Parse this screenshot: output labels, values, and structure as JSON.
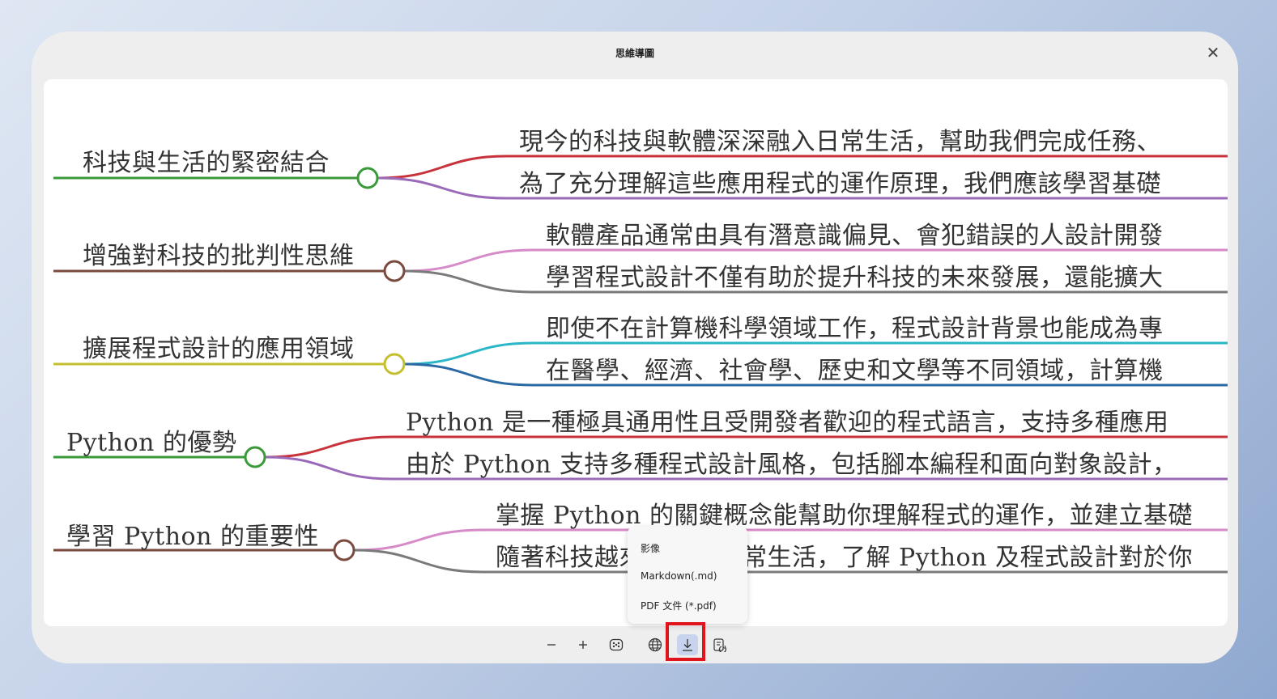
{
  "window": {
    "title": "思維導圖"
  },
  "mindmap": {
    "branches": [
      {
        "topic": "科技與生活的緊密結合",
        "node_color": "#3a9a3a",
        "children": [
          {
            "text": "現今的科技與軟體深深融入日常生活，幫助我們完成任務、",
            "color": "#c8323a"
          },
          {
            "text": "為了充分理解這些應用程式的運作原理，我們應該學習基礎",
            "color": "#9a6ab8"
          }
        ]
      },
      {
        "topic": "增強對科技的批判性思維",
        "node_color": "#7a4a3e",
        "children": [
          {
            "text": "軟體產品通常由具有潛意識偏見、會犯錯誤的人設計開發",
            "color": "#d78ac8"
          },
          {
            "text": "學習程式設計不僅有助於提升科技的未來發展，還能擴大",
            "color": "#7a7a7a"
          }
        ]
      },
      {
        "topic": "擴展程式設計的應用領域",
        "node_color": "#c4bf2e",
        "children": [
          {
            "text": "即使不在計算機科學領域工作，程式設計背景也能成為專",
            "color": "#28b6c8"
          },
          {
            "text": "在醫學、經濟、社會學、歷史和文學等不同領域，計算機",
            "color": "#2a6aa4"
          }
        ]
      },
      {
        "topic": "Python 的優勢",
        "node_color": "#3a9a3a",
        "children": [
          {
            "text": "Python 是一種極具通用性且受開發者歡迎的程式語言，支持多種應用",
            "color": "#c8323a"
          },
          {
            "text": "由於 Python 支持多種程式設計風格，包括腳本編程和面向對象設計，",
            "color": "#9a6ab8"
          }
        ]
      },
      {
        "topic": "學習 Python 的重要性",
        "node_color": "#7a4a3e",
        "children": [
          {
            "text": "掌握 Python 的關鍵概念能幫助你理解程式的運作，並建立基礎",
            "color": "#d78ac8"
          },
          {
            "text": "隨著科技越來越融入日常生活，了解 Python 及程式設計對於你",
            "color": "#7a7a7a"
          }
        ]
      }
    ]
  },
  "export_menu": {
    "items": [
      "影像",
      "Markdown(.md)",
      "PDF 文件 (*.pdf)"
    ]
  },
  "toolbar": {
    "buttons": [
      "zoom-out-icon",
      "zoom-in-icon",
      "layout-icon",
      "globe-icon",
      "download-icon",
      "convert-icon"
    ]
  }
}
